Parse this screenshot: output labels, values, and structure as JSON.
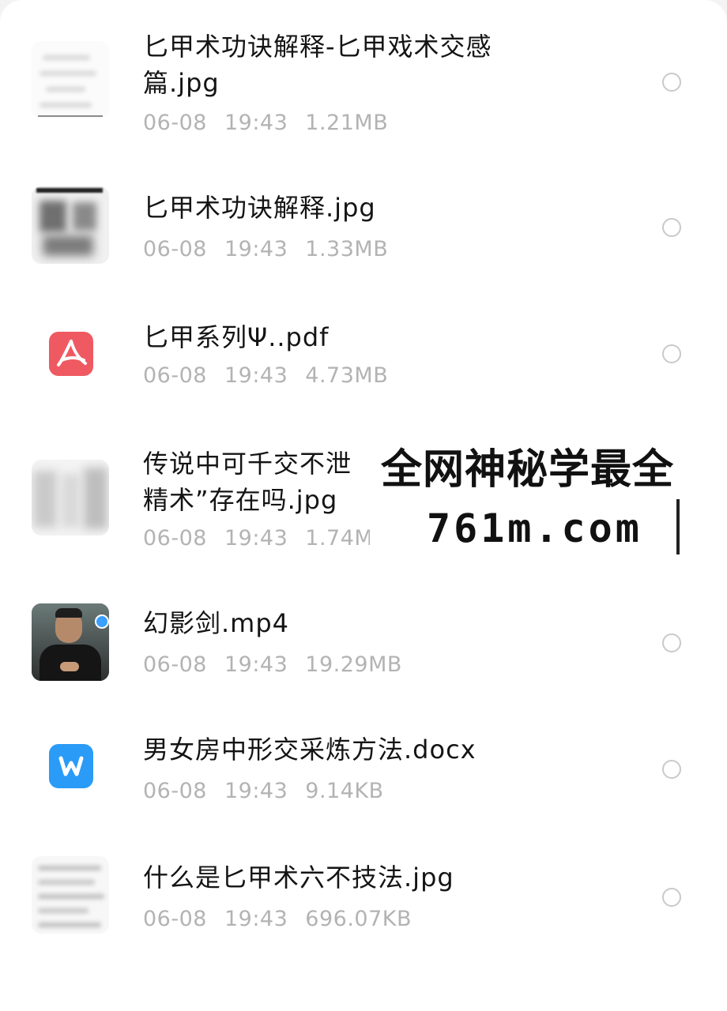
{
  "files": [
    {
      "name": "匕甲术功诀解释-匕甲戏术交感篇.jpg",
      "date": "06-08",
      "time": "19:43",
      "size": "1.21MB",
      "icon": "image-thumbnail"
    },
    {
      "name": "匕甲术功诀解释.jpg",
      "date": "06-08",
      "time": "19:43",
      "size": "1.33MB",
      "icon": "image-thumbnail"
    },
    {
      "name": "匕甲系列Ψ..pdf",
      "date": "06-08",
      "time": "19:43",
      "size": "4.73MB",
      "icon": "pdf-icon"
    },
    {
      "name": "传说中可千交不泄精术”存在吗.jpg",
      "date": "06-08",
      "time": "19:43",
      "size": "1.74M",
      "icon": "image-thumbnail"
    },
    {
      "name": "幻影剑.mp4",
      "date": "06-08",
      "time": "19:43",
      "size": "19.29MB",
      "icon": "video-thumbnail"
    },
    {
      "name": "男女房中形交采炼方法.docx",
      "date": "06-08",
      "time": "19:43",
      "size": "9.14KB",
      "icon": "word-icon"
    },
    {
      "name": "什么是匕甲术六不技法.jpg",
      "date": "06-08",
      "time": "19:43",
      "size": "696.07KB",
      "icon": "image-thumbnail"
    }
  ],
  "watermark": {
    "line1": "全网神秘学最全",
    "line2": "761m.com"
  },
  "colors": {
    "pdf": "#ef5a62",
    "word": "#2a9bf6",
    "meta_text": "#b3b3b3",
    "title_text": "#141414"
  }
}
